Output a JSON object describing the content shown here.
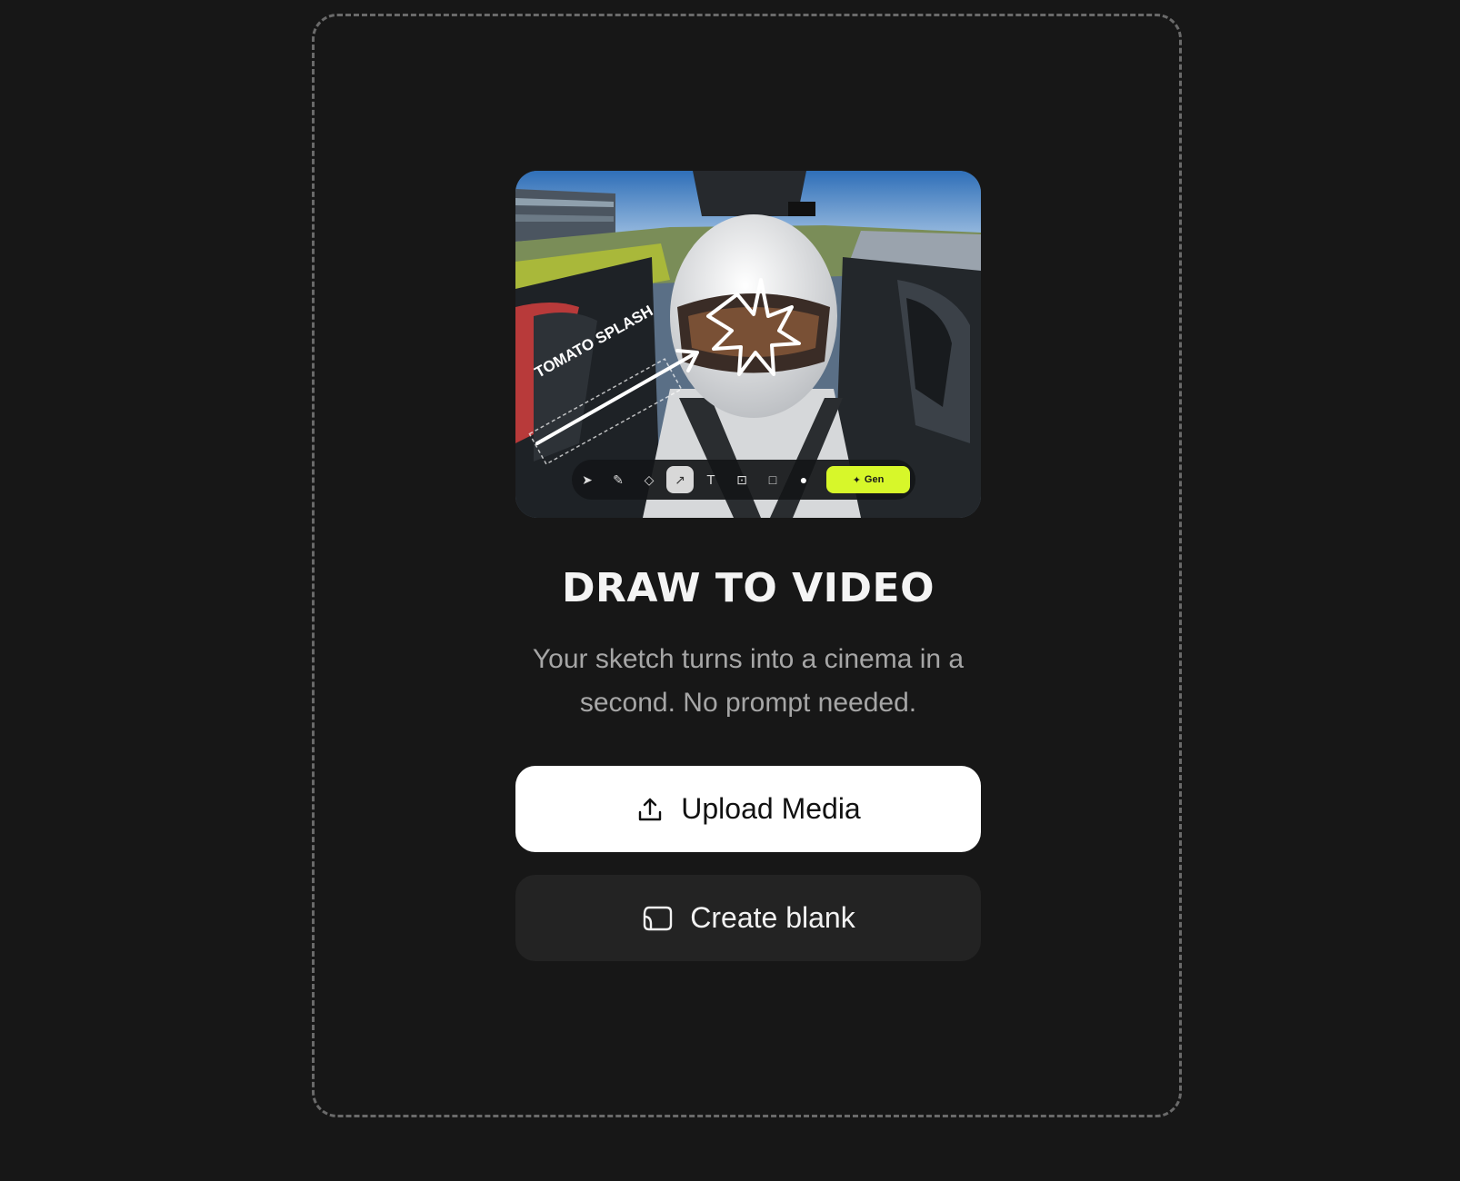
{
  "hero": {
    "image_caption": "TOMATO SPLASH",
    "generate_label": "Gen",
    "toolbar_icons": [
      "cursor-icon",
      "pencil-icon",
      "eraser-icon",
      "arrow-icon",
      "text-icon",
      "image-icon",
      "square-icon",
      "color-dot-icon"
    ]
  },
  "title": "DRAW TO VIDEO",
  "subtitle": "Your sketch turns into a cinema in a second. No prompt needed.",
  "buttons": {
    "upload_label": "Upload Media",
    "upload_icon": "upload-icon",
    "blank_label": "Create blank",
    "blank_icon": "blank-canvas-icon"
  },
  "colors": {
    "background": "#171717",
    "accent": "#d7f72a",
    "upload_bg": "#ffffff",
    "blank_bg": "#232323"
  }
}
